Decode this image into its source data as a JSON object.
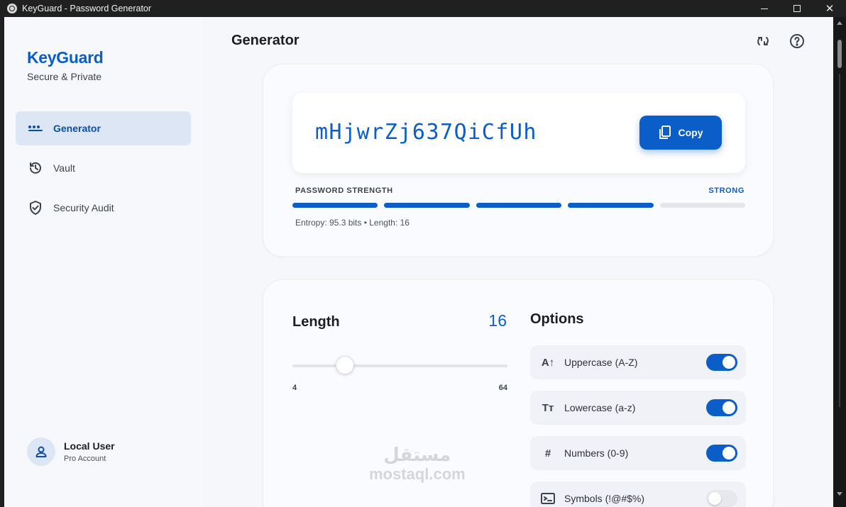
{
  "window": {
    "title": "KeyGuard - Password Generator"
  },
  "sidebar": {
    "brand": "KeyGuard",
    "tagline": "Secure & Private",
    "items": [
      {
        "label": "Generator",
        "icon": "dots-icon",
        "active": true
      },
      {
        "label": "Vault",
        "icon": "history-icon",
        "active": false
      },
      {
        "label": "Security Audit",
        "icon": "shield-icon",
        "active": false
      }
    ],
    "user": {
      "name": "Local User",
      "role": "Pro Account"
    }
  },
  "header": {
    "title": "Generator",
    "icons": [
      "refresh-icon",
      "help-icon"
    ]
  },
  "password": {
    "value": "mHjwrZj637QiCfUh",
    "copy_label": "Copy",
    "strength_label": "PASSWORD STRENGTH",
    "strength_value": "STRONG",
    "strength_segments_filled": 4,
    "strength_segments_total": 5,
    "entropy_text": "Entropy: 95.3 bits • Length: 16"
  },
  "length": {
    "label": "Length",
    "value": "16",
    "min": "4",
    "max": "64"
  },
  "options": {
    "title": "Options",
    "items": [
      {
        "label": "Uppercase (A-Z)",
        "icon": "uppercase-icon",
        "glyph": "A↑",
        "enabled": true
      },
      {
        "label": "Lowercase (a-z)",
        "icon": "text-case-icon",
        "glyph": "Tт",
        "enabled": true
      },
      {
        "label": "Numbers (0-9)",
        "icon": "hash-icon",
        "glyph": "#",
        "enabled": true
      },
      {
        "label": "Symbols (!@#$%)",
        "icon": "terminal-icon",
        "glyph": "",
        "enabled": false
      }
    ]
  },
  "watermark": {
    "arabic": "مستقل",
    "latin": "mostaql.com"
  },
  "colors": {
    "accent": "#0b5ec7",
    "active_nav_bg": "#dde6f5",
    "background": "#f6f7fb",
    "titlebar": "#202020"
  }
}
